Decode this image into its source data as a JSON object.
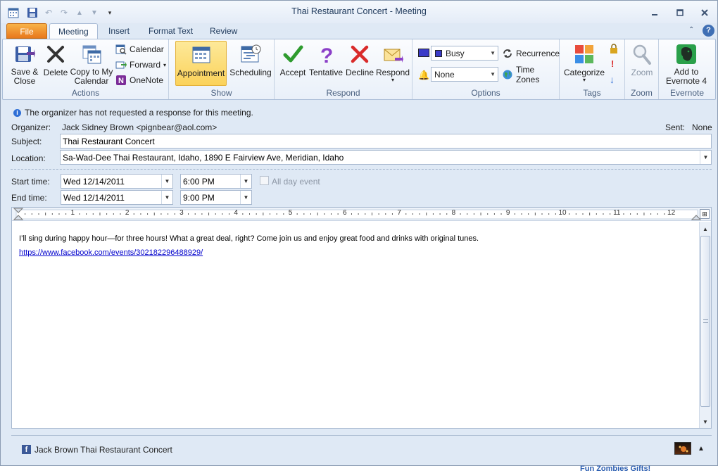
{
  "window": {
    "title": "Thai Restaurant Concert  -  Meeting"
  },
  "tabs": [
    "File",
    "Meeting",
    "Insert",
    "Format Text",
    "Review"
  ],
  "ribbon": {
    "actions": {
      "label": "Actions",
      "save_close": [
        "Save &",
        "Close"
      ],
      "delete": "Delete",
      "copy_to_calendar": [
        "Copy to My",
        "Calendar"
      ],
      "calendar": "Calendar",
      "forward": "Forward",
      "onenote": "OneNote"
    },
    "show": {
      "label": "Show",
      "appointment": "Appointment",
      "scheduling": "Scheduling"
    },
    "respond": {
      "label": "Respond",
      "accept": "Accept",
      "tentative": "Tentative",
      "decline": "Decline",
      "respond": "Respond"
    },
    "options": {
      "label": "Options",
      "show_as": "Busy",
      "reminder": "None",
      "recurrence": "Recurrence",
      "time_zones": "Time Zones"
    },
    "tags": {
      "label": "Tags",
      "categorize": "Categorize"
    },
    "zoom": {
      "label": "Zoom",
      "zoom": "Zoom"
    },
    "evernote": {
      "label": "Evernote",
      "add": [
        "Add to",
        "Evernote 4"
      ]
    }
  },
  "info": {
    "message": "The organizer has not requested a response for this meeting."
  },
  "form": {
    "organizer_label": "Organizer:",
    "organizer": "Jack Sidney Brown <pignbear@aol.com>",
    "sent_label": "Sent:",
    "sent": "None",
    "subject_label": "Subject:",
    "subject": "Thai Restaurant Concert",
    "location_label": "Location:",
    "location": "Sa-Wad-Dee Thai Restaurant, Idaho, 1890 E Fairview Ave, Meridian, Idaho",
    "start_label": "Start time:",
    "start_date": "Wed 12/14/2011",
    "start_time": "6:00 PM",
    "all_day": "All day event",
    "end_label": "End time:",
    "end_date": "Wed 12/14/2011",
    "end_time": "9:00 PM"
  },
  "ruler": [
    "1",
    "2",
    "3",
    "4",
    "5",
    "6",
    "7",
    "8",
    "9",
    "10",
    "11",
    "12"
  ],
  "body": {
    "text": "I’ll sing during happy hour—for three hours!  What a great deal, right?  Come join us and enjoy great food and drinks with original tunes.",
    "link": "https://www.facebook.com/events/302182296488929/"
  },
  "footer": {
    "label": "Jack Brown Thai Restaurant Concert"
  },
  "background_text": "Fun Zombies Gifts!",
  "colors": {
    "file_tab": "#e8781c",
    "accept": "#2e9b2e",
    "tentative": "#8b3fc8",
    "decline": "#d92b2b",
    "busy": "#3a3ac8",
    "evernote": "#2aa04a"
  }
}
